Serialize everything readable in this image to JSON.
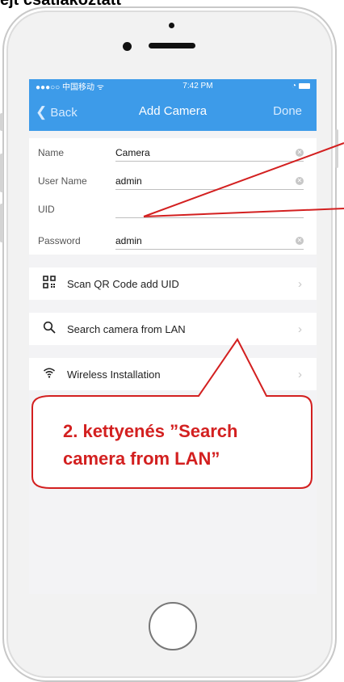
{
  "caption": "ejt csatlakoztatt",
  "status_bar": {
    "carrier": "●●●○○ 中国移动 ᯤ",
    "time": "7:42 PM",
    "right": "◔"
  },
  "nav": {
    "back": "Back",
    "title": "Add Camera",
    "done": "Done"
  },
  "form": {
    "rows": [
      {
        "label": "Name",
        "value": "Camera",
        "clearable": true
      },
      {
        "label": "User Name",
        "value": "admin",
        "clearable": true
      },
      {
        "label": "UID",
        "value": "",
        "clearable": false
      },
      {
        "label": "Password",
        "value": "admin",
        "clearable": true
      }
    ]
  },
  "menu": [
    {
      "icon": "qr-code-icon",
      "label": "Scan QR Code add UID"
    },
    {
      "icon": "search-icon",
      "label": "Search camera from LAN"
    },
    {
      "icon": "wifi-icon",
      "label": "Wireless Installation"
    }
  ],
  "callout": {
    "line1": "2. kettyenés ”Search",
    "line2": "camera from LAN”"
  },
  "colors": {
    "nav_bg": "#3d9be9",
    "annotation": "#d32020"
  }
}
